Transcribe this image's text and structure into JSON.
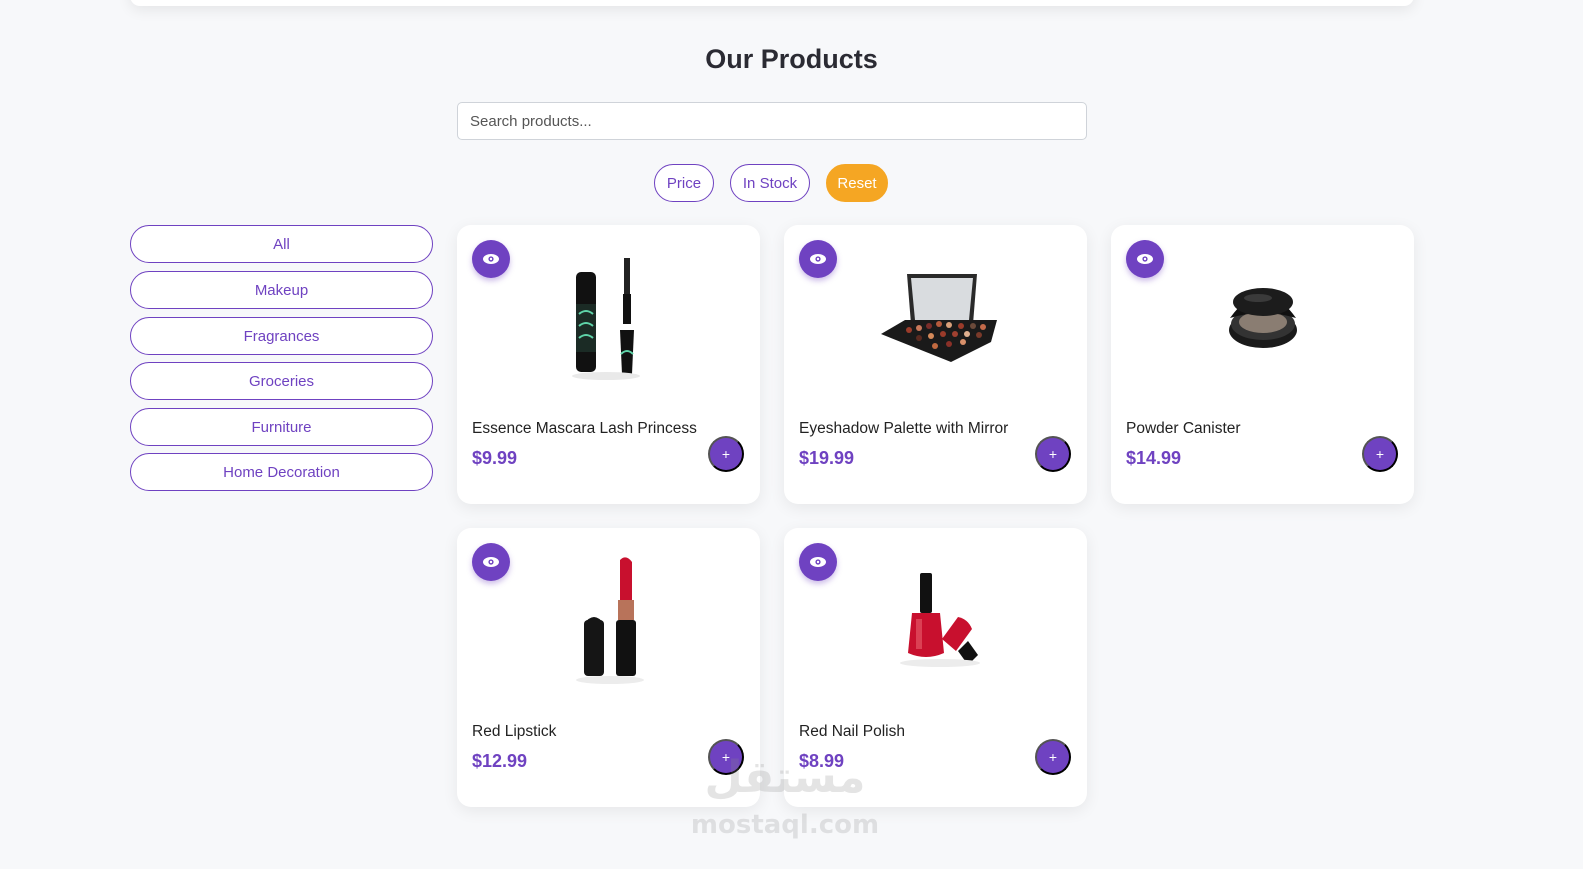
{
  "header": {
    "title": "Our Products"
  },
  "search": {
    "placeholder": "Search products..."
  },
  "filters": {
    "price_label": "Price",
    "in_stock_label": "In Stock",
    "reset_label": "Reset"
  },
  "categories": [
    "All",
    "Makeup",
    "Fragrances",
    "Groceries",
    "Furniture",
    "Home Decoration"
  ],
  "products": [
    {
      "name": "Essence Mascara Lash Princess",
      "price": "$9.99",
      "image": "mascara-image"
    },
    {
      "name": "Eyeshadow Palette with Mirror",
      "price": "$19.99",
      "image": "eyeshadow-palette-image"
    },
    {
      "name": "Powder Canister",
      "price": "$14.99",
      "image": "powder-canister-image"
    },
    {
      "name": "Red Lipstick",
      "price": "$12.99",
      "image": "lipstick-image"
    },
    {
      "name": "Red Nail Polish",
      "price": "$8.99",
      "image": "nail-polish-image"
    }
  ],
  "card_actions": {
    "add_label": "+",
    "view_icon": "eye-icon"
  },
  "colors": {
    "accent": "#6f42c1",
    "reset": "#f5a623",
    "background": "#f7f8fa"
  },
  "watermark": {
    "arabic": "مستقل",
    "latin": "mostaql.com"
  }
}
